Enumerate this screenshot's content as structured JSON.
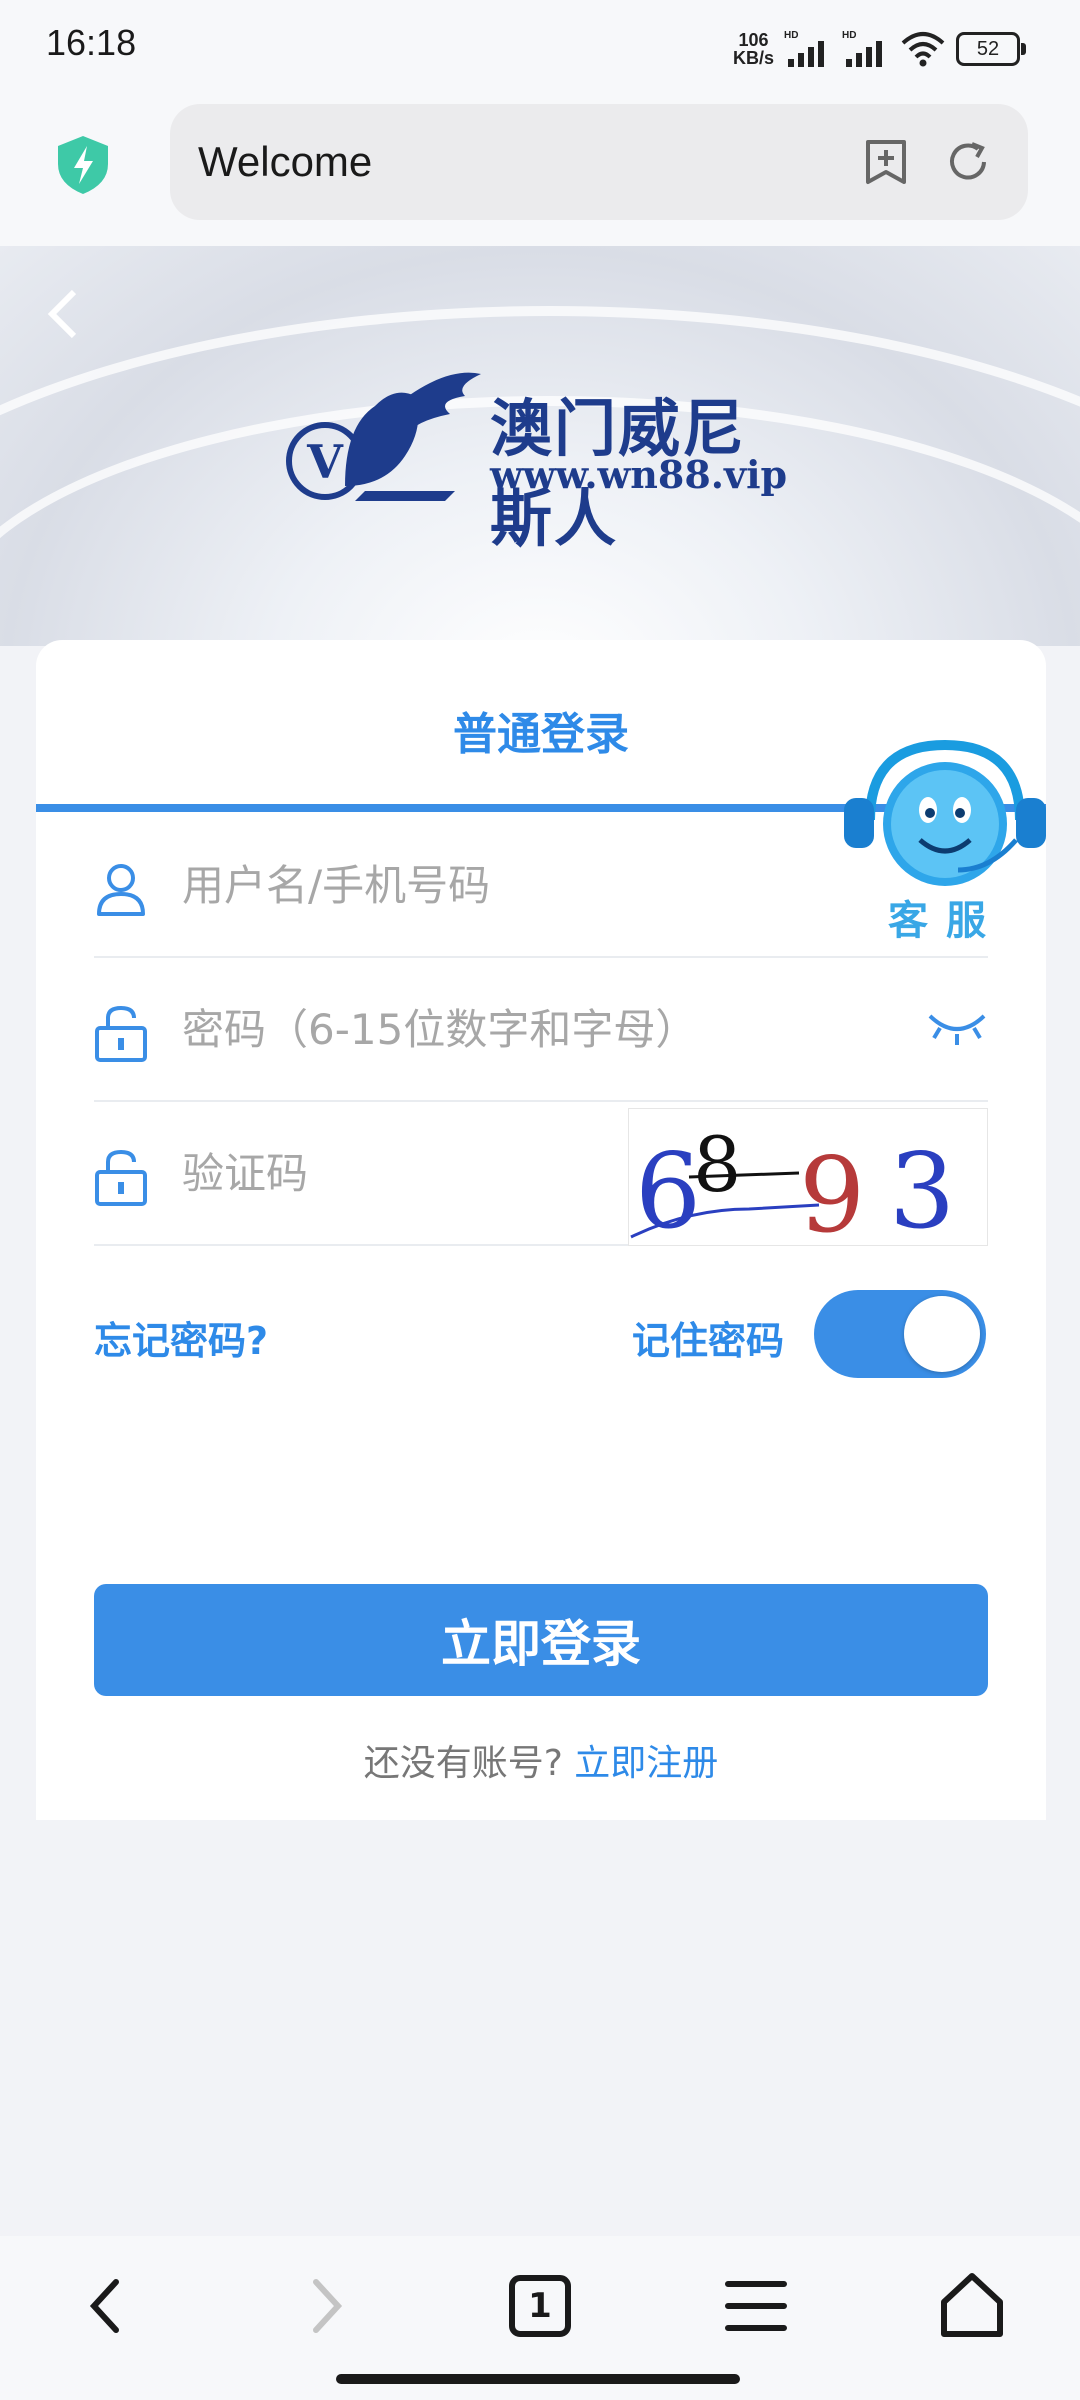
{
  "status_bar": {
    "time": "16:18",
    "net_speed_value": "106",
    "net_speed_unit": "KB/s",
    "signal_label_1": "HD",
    "signal_label_2": "HD",
    "battery": "52"
  },
  "browser": {
    "address_text": "Welcome"
  },
  "logo": {
    "cn_name": "澳门威尼斯人",
    "url": "www.wn88.vip"
  },
  "login": {
    "tab_title": "普通登录",
    "username_placeholder": "用户名/手机号码",
    "password_placeholder": "密码（6-15位数字和字母）",
    "captcha_placeholder": "验证码",
    "captcha_digits": [
      "6",
      "8",
      "9",
      "3"
    ],
    "forgot_password": "忘记密码?",
    "remember_password": "记住密码",
    "remember_enabled": true,
    "login_button": "立即登录",
    "no_account_text": "还没有账号?",
    "register_link": "立即注册"
  },
  "customer_service": {
    "label": "客服"
  },
  "colors": {
    "accent": "#3a8ee6",
    "brand_navy": "#1e3c8c"
  },
  "bottom_nav": {
    "tab_count": "1"
  }
}
